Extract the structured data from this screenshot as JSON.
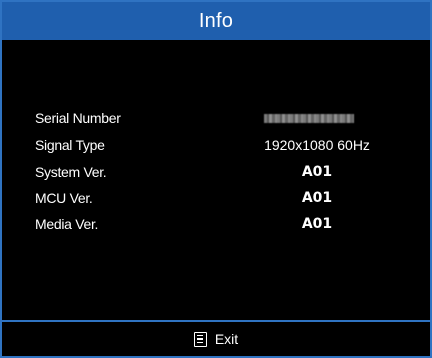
{
  "window": {
    "title": "Info",
    "accent_color": "#1f5fae",
    "border_color": "#2f73c2",
    "background_color": "#000000"
  },
  "info_rows": [
    {
      "label": "Serial Number",
      "value": null,
      "value_redacted": true
    },
    {
      "label": "Signal Type",
      "value": "1920x1080 60Hz"
    },
    {
      "label": "System Ver.",
      "value": "A01"
    },
    {
      "label": "MCU Ver.",
      "value": "A01"
    },
    {
      "label": "Media Ver.",
      "value": "A01"
    }
  ],
  "footer": {
    "exit_icon": "menu-icon",
    "exit_label": "Exit"
  }
}
